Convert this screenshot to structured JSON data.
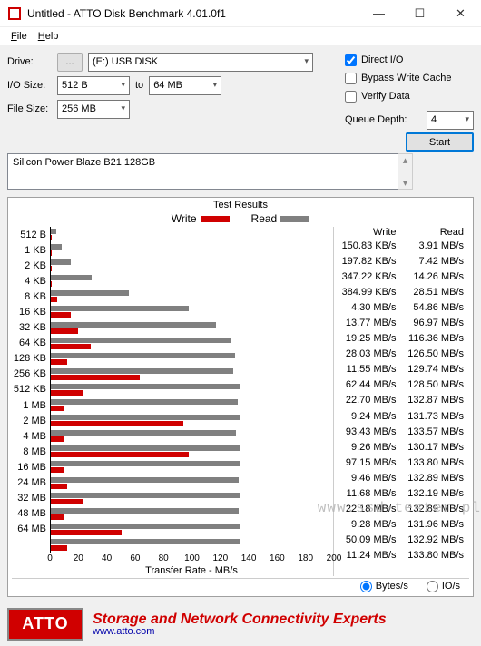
{
  "window": {
    "title": "Untitled - ATTO Disk Benchmark 4.01.0f1",
    "minimize": "—",
    "maximize": "☐",
    "close": "✕"
  },
  "menu": {
    "file": "File",
    "help": "Help"
  },
  "controls": {
    "drive_label": "Drive:",
    "drive_browse": "...",
    "drive_value": "(E:) USB DISK",
    "iosize_label": "I/O Size:",
    "iosize_from": "512 B",
    "to_label": "to",
    "iosize_to": "64 MB",
    "filesize_label": "File Size:",
    "filesize_value": "256 MB",
    "direct_io": "Direct I/O",
    "bypass_cache": "Bypass Write Cache",
    "verify_data": "Verify Data",
    "queue_label": "Queue Depth:",
    "queue_value": "4",
    "start": "Start"
  },
  "device_text": "Silicon Power Blaze B21 128GB",
  "results": {
    "header": "Test Results",
    "legend_write": "Write",
    "legend_read": "Read",
    "col_write": "Write",
    "col_read": "Read",
    "xlabel": "Transfer Rate - MB/s",
    "units_bytes": "Bytes/s",
    "units_ios": "IO/s"
  },
  "colors": {
    "write": "#d00000",
    "read": "#808080"
  },
  "banner": {
    "logo": "ATTO",
    "tagline": "Storage and Network Connectivity Experts",
    "url": "www.atto.com"
  },
  "watermark": "www.ssd-tester.pl",
  "chart_data": {
    "type": "bar",
    "xlabel": "Transfer Rate - MB/s",
    "xlim": [
      0,
      200
    ],
    "xticks": [
      0,
      20,
      40,
      60,
      80,
      100,
      120,
      140,
      160,
      180,
      200
    ],
    "series": [
      "Write",
      "Read"
    ],
    "rows": [
      {
        "label": "512 B",
        "write": "150.83 KB/s",
        "read": "3.91 MB/s",
        "write_mb": 0.15,
        "read_mb": 3.91
      },
      {
        "label": "1 KB",
        "write": "197.82 KB/s",
        "read": "7.42 MB/s",
        "write_mb": 0.2,
        "read_mb": 7.42
      },
      {
        "label": "2 KB",
        "write": "347.22 KB/s",
        "read": "14.26 MB/s",
        "write_mb": 0.35,
        "read_mb": 14.26
      },
      {
        "label": "4 KB",
        "write": "384.99 KB/s",
        "read": "28.51 MB/s",
        "write_mb": 0.38,
        "read_mb": 28.51
      },
      {
        "label": "8 KB",
        "write": "4.30 MB/s",
        "read": "54.86 MB/s",
        "write_mb": 4.3,
        "read_mb": 54.86
      },
      {
        "label": "16 KB",
        "write": "13.77 MB/s",
        "read": "96.97 MB/s",
        "write_mb": 13.77,
        "read_mb": 96.97
      },
      {
        "label": "32 KB",
        "write": "19.25 MB/s",
        "read": "116.36 MB/s",
        "write_mb": 19.25,
        "read_mb": 116.36
      },
      {
        "label": "64 KB",
        "write": "28.03 MB/s",
        "read": "126.50 MB/s",
        "write_mb": 28.03,
        "read_mb": 126.5
      },
      {
        "label": "128 KB",
        "write": "11.55 MB/s",
        "read": "129.74 MB/s",
        "write_mb": 11.55,
        "read_mb": 129.74
      },
      {
        "label": "256 KB",
        "write": "62.44 MB/s",
        "read": "128.50 MB/s",
        "write_mb": 62.44,
        "read_mb": 128.5
      },
      {
        "label": "512 KB",
        "write": "22.70 MB/s",
        "read": "132.87 MB/s",
        "write_mb": 22.7,
        "read_mb": 132.87
      },
      {
        "label": "1 MB",
        "write": "9.24 MB/s",
        "read": "131.73 MB/s",
        "write_mb": 9.24,
        "read_mb": 131.73
      },
      {
        "label": "2 MB",
        "write": "93.43 MB/s",
        "read": "133.57 MB/s",
        "write_mb": 93.43,
        "read_mb": 133.57
      },
      {
        "label": "4 MB",
        "write": "9.26 MB/s",
        "read": "130.17 MB/s",
        "write_mb": 9.26,
        "read_mb": 130.17
      },
      {
        "label": "8 MB",
        "write": "97.15 MB/s",
        "read": "133.80 MB/s",
        "write_mb": 97.15,
        "read_mb": 133.8
      },
      {
        "label": "16 MB",
        "write": "9.46 MB/s",
        "read": "132.89 MB/s",
        "write_mb": 9.46,
        "read_mb": 132.89
      },
      {
        "label": "24 MB",
        "write": "11.68 MB/s",
        "read": "132.19 MB/s",
        "write_mb": 11.68,
        "read_mb": 132.19
      },
      {
        "label": "32 MB",
        "write": "22.18 MB/s",
        "read": "132.89 MB/s",
        "write_mb": 22.18,
        "read_mb": 132.89
      },
      {
        "label": "48 MB",
        "write": "9.28 MB/s",
        "read": "131.96 MB/s",
        "write_mb": 9.28,
        "read_mb": 131.96
      },
      {
        "label": "64 MB",
        "write": "50.09 MB/s",
        "read": "132.92 MB/s",
        "write_mb": 50.09,
        "read_mb": 132.92
      },
      {
        "label": "",
        "write": "11.24 MB/s",
        "read": "133.80 MB/s",
        "write_mb": 11.24,
        "read_mb": 133.8
      }
    ]
  }
}
